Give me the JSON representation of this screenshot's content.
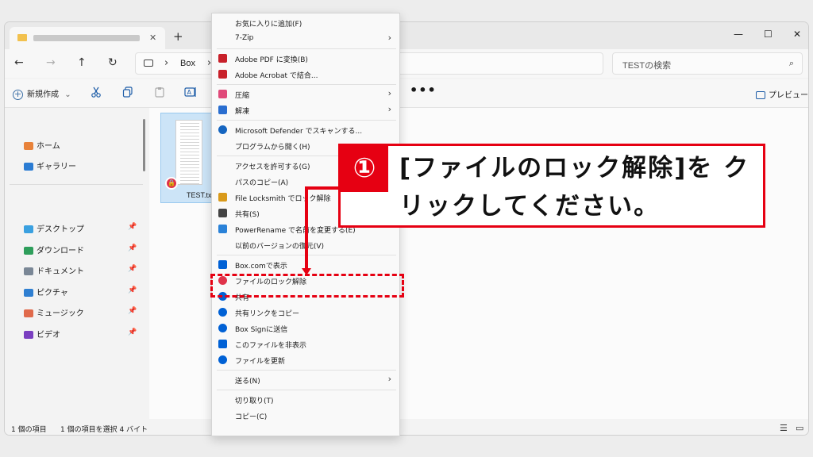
{
  "tab": {
    "close_glyph": "✕",
    "add_glyph": "+"
  },
  "window_controls": {
    "minimize": "—",
    "maximize": "☐",
    "close": "✕"
  },
  "nav": {
    "back": "←",
    "forward": "→",
    "up": "↑",
    "refresh": "↻"
  },
  "address": {
    "separator": "›",
    "location": "Box",
    "trail": "›"
  },
  "search": {
    "placeholder": "TESTの検索",
    "icon": "⌕"
  },
  "toolbar": {
    "new_label": "新規作成",
    "new_caret": "⌄",
    "icons": [
      "cut-icon",
      "copy-icon",
      "paste-icon",
      "rename-icon"
    ],
    "more": "•••",
    "preview_label": "プレビュー"
  },
  "sidebar": {
    "top": [
      {
        "label": "ホーム",
        "icon": "home-icon",
        "color": "#e8823a"
      },
      {
        "label": "ギャラリー",
        "icon": "gallery-icon",
        "color": "#2b7cd3"
      }
    ],
    "pinned": [
      {
        "label": "デスクトップ",
        "icon": "desktop-icon",
        "color": "#3aa0e0"
      },
      {
        "label": "ダウンロード",
        "icon": "download-icon",
        "color": "#2e9e5b"
      },
      {
        "label": "ドキュメント",
        "icon": "documents-icon",
        "color": "#7a8796"
      },
      {
        "label": "ピクチャ",
        "icon": "pictures-icon",
        "color": "#2f7fd1"
      },
      {
        "label": "ミュージック",
        "icon": "music-icon",
        "color": "#e06a4b"
      },
      {
        "label": "ビデオ",
        "icon": "videos-icon",
        "color": "#7a3fc0"
      }
    ],
    "pin_glyph": "📌"
  },
  "file": {
    "name": "TEST.tx",
    "lock_glyph": "🔒"
  },
  "status": {
    "count": "1 個の項目",
    "selected": "1 個の項目を選択 4 バイト"
  },
  "context_menu": [
    {
      "label": "お気に入りに追加(F)",
      "icon": "",
      "color": "",
      "arrow": ""
    },
    {
      "label": "7-Zip",
      "icon": "",
      "color": "",
      "arrow": "›"
    },
    {
      "sep": true
    },
    {
      "label": "Adobe PDF に変換(B)",
      "icon": "adobe-pdf-icon",
      "color": "#c8202a",
      "arrow": ""
    },
    {
      "label": "Adobe Acrobat で結合...",
      "icon": "adobe-acrobat-icon",
      "color": "#c8202a",
      "arrow": ""
    },
    {
      "sep": true
    },
    {
      "label": "圧縮",
      "icon": "archive-icon",
      "color": "#e04a7a",
      "arrow": "›"
    },
    {
      "label": "解凍",
      "icon": "extract-icon",
      "color": "#2a6ed0",
      "arrow": "›"
    },
    {
      "sep": true
    },
    {
      "label": "Microsoft Defender でスキャンする...",
      "icon": "defender-icon",
      "color": "#1565c0",
      "arrow": ""
    },
    {
      "label": "プログラムから開く(H)",
      "icon": "",
      "color": "",
      "arrow": ""
    },
    {
      "sep": true
    },
    {
      "label": "アクセスを許可する(G)",
      "icon": "",
      "color": "",
      "arrow": ""
    },
    {
      "label": "パスのコピー(A)",
      "icon": "",
      "color": "",
      "arrow": ""
    },
    {
      "label": "File Locksmith でロック解除",
      "icon": "locksmith-icon",
      "color": "#d99a1b",
      "arrow": ""
    },
    {
      "label": "共有(S)",
      "icon": "share-icon",
      "color": "#444444",
      "arrow": ""
    },
    {
      "label": "PowerRename で名前を変更する(E)",
      "icon": "powerrename-icon",
      "color": "#2a82d8",
      "arrow": ""
    },
    {
      "label": "以前のバージョンの復元(V)",
      "icon": "",
      "color": "",
      "arrow": ""
    },
    {
      "sep": true
    },
    {
      "label": "Box.comで表示",
      "icon": "box-icon",
      "color": "#0061d5",
      "arrow": ""
    },
    {
      "label": "ファイルのロック解除",
      "icon": "unlock-icon",
      "color": "#e0334a",
      "arrow": ""
    },
    {
      "label": "共有",
      "icon": "box-share-icon",
      "color": "#0061d5",
      "arrow": ""
    },
    {
      "label": "共有リンクをコピー",
      "icon": "link-icon",
      "color": "#0061d5",
      "arrow": ""
    },
    {
      "label": "Box Signに送信",
      "icon": "box-sign-icon",
      "color": "#0061d5",
      "arrow": ""
    },
    {
      "label": "このファイルを非表示",
      "icon": "box-hide-icon",
      "color": "#0061d5",
      "arrow": ""
    },
    {
      "label": "ファイルを更新",
      "icon": "refresh-icon",
      "color": "#0061d5",
      "arrow": ""
    },
    {
      "sep": true
    },
    {
      "label": "送る(N)",
      "icon": "",
      "color": "",
      "arrow": "›"
    },
    {
      "sep": true
    },
    {
      "label": "切り取り(T)",
      "icon": "",
      "color": "",
      "arrow": ""
    },
    {
      "label": "コピー(C)",
      "icon": "",
      "color": "",
      "arrow": ""
    }
  ],
  "callout": {
    "number": "①",
    "text": "[ファイルのロック解除]を クリックしてください。"
  },
  "colors": {
    "accent": "#e60012",
    "selection": "#cce4f7"
  }
}
